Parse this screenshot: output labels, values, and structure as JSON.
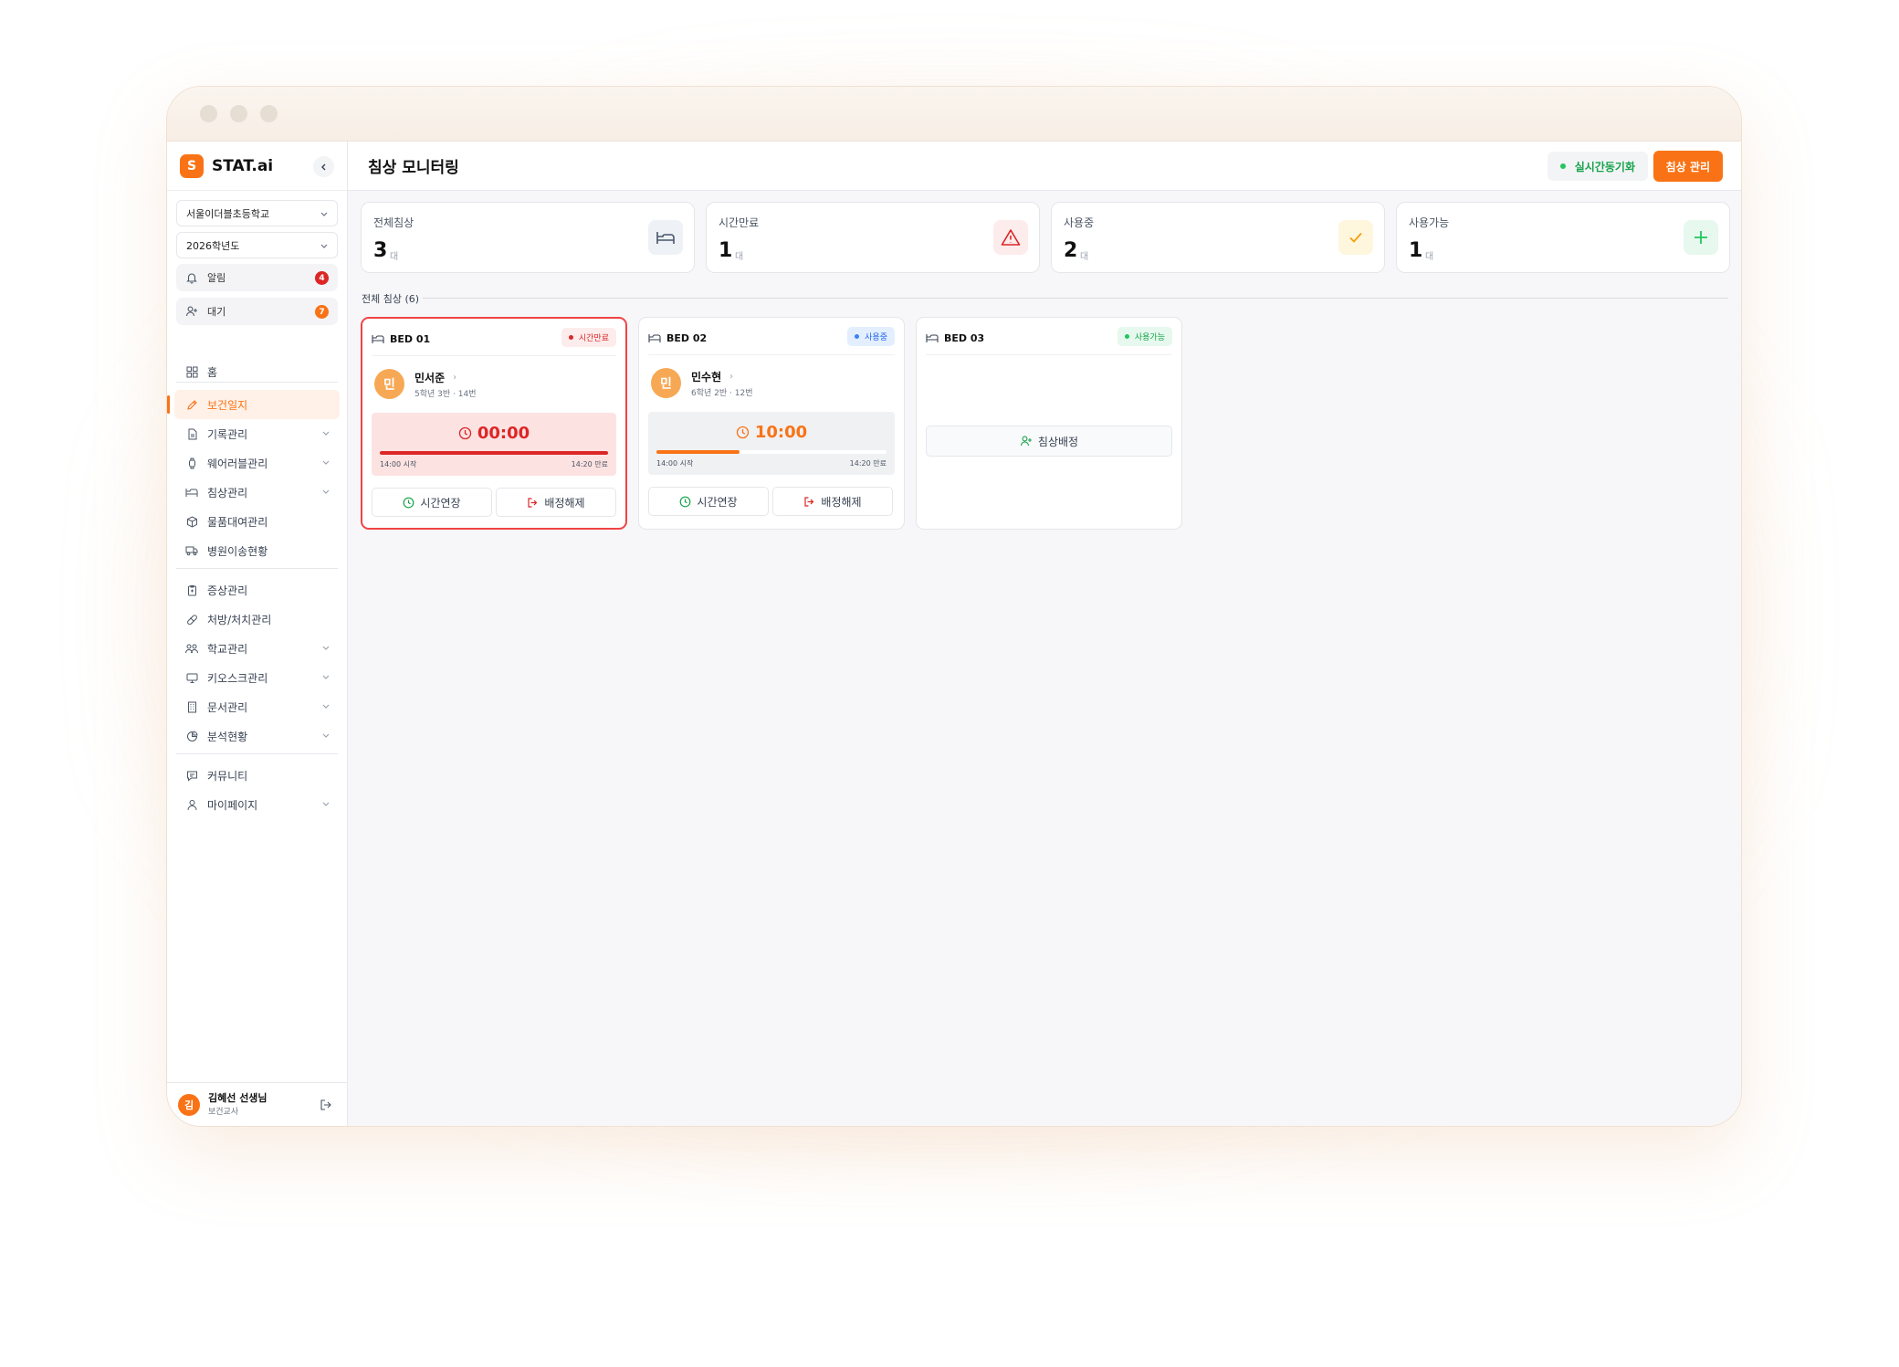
{
  "sidebar": {
    "brand_letter": "S",
    "brand_name": "STAT.ai",
    "school": "서울이더블초등학교",
    "year": "2026학년도",
    "alerts_label": "알림",
    "alerts_count": "4",
    "waiting_label": "대기",
    "waiting_count": "7",
    "nav": {
      "home": "홈",
      "health_log": "보건일지",
      "records": "기록관리",
      "wearables": "웨어러블관리",
      "beds": "침상관리",
      "rentals": "물품대여관리",
      "hospital": "병원이송현황",
      "symptoms": "증상관리",
      "prescriptions": "처방/처치관리",
      "school": "학교관리",
      "kiosk": "키오스크관리",
      "documents": "문서관리",
      "analytics": "분석현황",
      "community": "커뮤니티",
      "mypage": "마이페이지"
    },
    "user": {
      "initial": "김",
      "name": "김혜선 선생님",
      "role": "보건교사"
    }
  },
  "header": {
    "title": "침상 모니터링",
    "live_sync_label": "실시간동기화",
    "manage_label": "침상 관리"
  },
  "stats": [
    {
      "label": "전체침상",
      "value": "3",
      "unit": "대",
      "icon": "bed-icon"
    },
    {
      "label": "시간만료",
      "value": "1",
      "unit": "대",
      "icon": "warning-icon"
    },
    {
      "label": "사용중",
      "value": "2",
      "unit": "대",
      "icon": "check-icon"
    },
    {
      "label": "사용가능",
      "value": "1",
      "unit": "대",
      "icon": "plus-icon"
    }
  ],
  "section_title": "전체 침상 (6)",
  "beds": [
    {
      "name": "BED 01",
      "status": "시간만료",
      "patient_initial": "민",
      "patient_name": "민서준",
      "patient_info": "5학년 3반 · 14번",
      "timer": "00:00",
      "progress": 1.0,
      "start": "14:00 시작",
      "end": "14:20 만료",
      "extend_label": "시간연장",
      "release_label": "배정해제"
    },
    {
      "name": "BED 02",
      "status": "사용중",
      "patient_initial": "민",
      "patient_name": "민수현",
      "patient_info": "6학년 2반 · 12번",
      "timer": "10:00",
      "progress": 0.36,
      "start": "14:00 시작",
      "end": "14:20 만료",
      "extend_label": "시간연장",
      "release_label": "배정해제"
    },
    {
      "name": "BED 03",
      "status": "사용가능",
      "assign_label": "침상배정"
    }
  ],
  "colors": {
    "accent": "#f97316",
    "expired": "#ef4444",
    "in_use": "#3b82f6",
    "available": "#22c55e"
  }
}
